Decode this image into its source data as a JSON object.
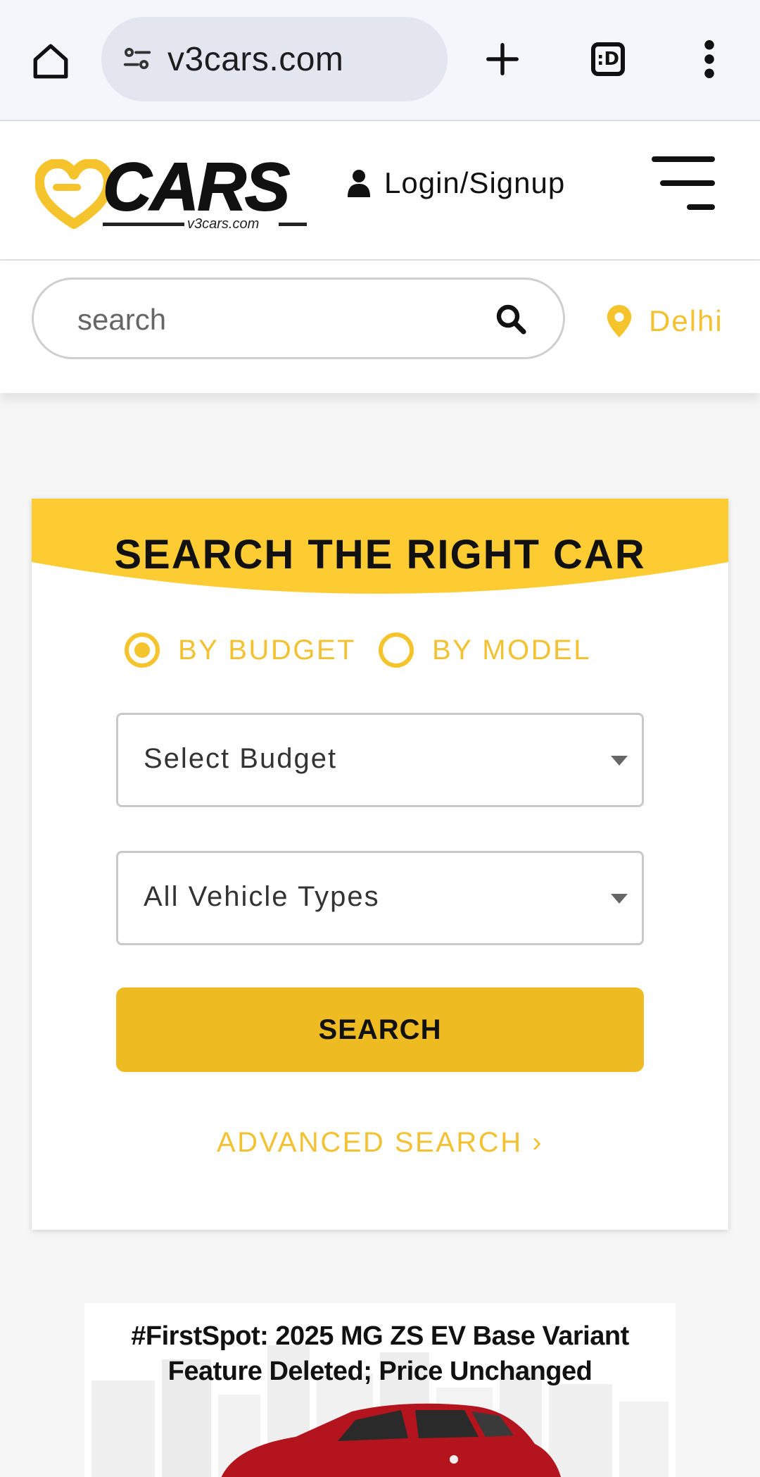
{
  "browser": {
    "url": "v3cars.com",
    "tabs_count_label": ":D"
  },
  "header": {
    "logo_text": "CARS",
    "logo_subtext": "v3cars.com",
    "login_label": "Login/Signup"
  },
  "search": {
    "placeholder": "search",
    "location": "Delhi"
  },
  "finder": {
    "title": "SEARCH THE RIGHT CAR",
    "options": [
      {
        "label": "BY BUDGET",
        "selected": true
      },
      {
        "label": "BY MODEL",
        "selected": false
      }
    ],
    "budget_select": "Select Budget",
    "vehicle_select": "All Vehicle Types",
    "search_button": "SEARCH",
    "advanced_link": "ADVANCED SEARCH ›"
  },
  "article": {
    "title_line1": "#FirstSpot: 2025 MG ZS EV Base Variant",
    "title_line2": "Feature Deleted; Price Unchanged"
  },
  "colors": {
    "accent": "#F2C233",
    "button": "#EFBB22",
    "banner_car": "#B3141E"
  }
}
